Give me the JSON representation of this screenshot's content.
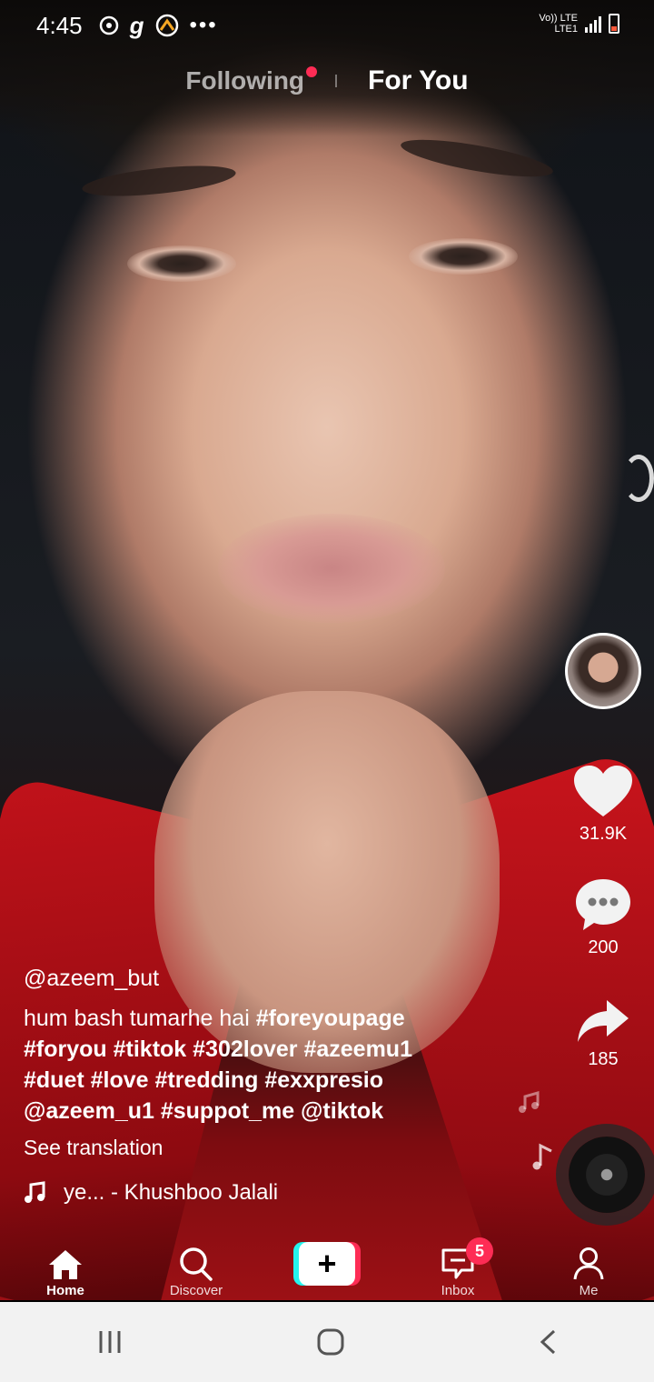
{
  "status_bar": {
    "time": "4:45",
    "left_icons": [
      "aperture-icon",
      "g-icon",
      "app-icon",
      "more-dots-icon"
    ],
    "network_top": "Vo)) LTE",
    "network_bottom": "LTE1"
  },
  "top_tabs": {
    "following": "Following",
    "for_you": "For You",
    "active": "For You"
  },
  "video": {
    "username": "@azeem_but",
    "description_text": "hum bash tumarhe hai ",
    "description_tags_line1": "#foreyoupage",
    "description_line2": "#foryou #tiktok #302lover #azeemu1",
    "description_line3": "#duet #love #tredding #exxpresio",
    "description_line4": "@azeem_u1 #suppot_me @tiktok",
    "see_translation": "See translation",
    "sound": "ye... - Khushboo Jalali"
  },
  "rail": {
    "likes": "31.9K",
    "comments": "200",
    "shares": "185"
  },
  "bottom_nav": {
    "home": "Home",
    "discover": "Discover",
    "create": "+",
    "inbox": "Inbox",
    "inbox_badge": "5",
    "me": "Me"
  },
  "colors": {
    "accent_red": "#fe2c55",
    "accent_cyan": "#25f4ee"
  }
}
